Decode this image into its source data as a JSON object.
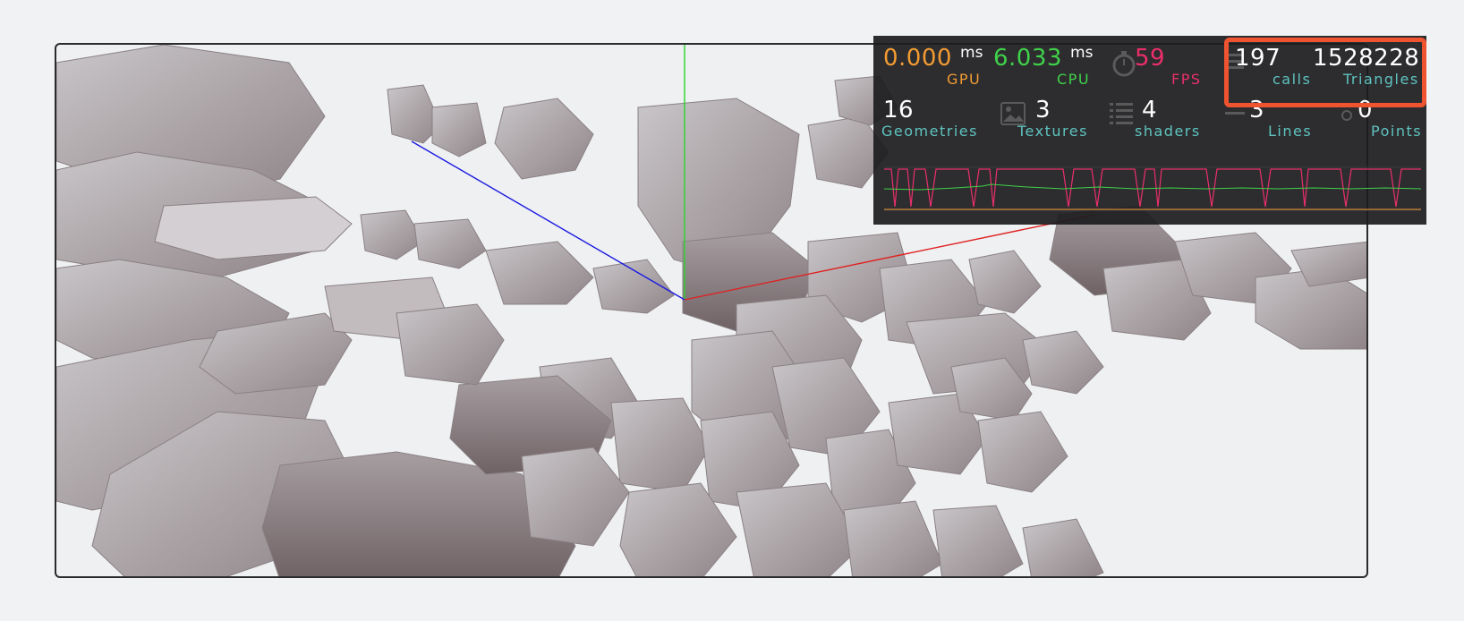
{
  "perf": {
    "gpu": {
      "value": "0.000",
      "unit": "ms",
      "label": "GPU"
    },
    "cpu": {
      "value": "6.033",
      "unit": "ms",
      "label": "CPU"
    },
    "fps": {
      "value": "59",
      "label": "FPS"
    },
    "calls": {
      "value": "197",
      "label": "calls"
    },
    "triangles": {
      "value": "1528228",
      "label": "Triangles"
    },
    "geometries": {
      "value": "16",
      "label": "Geometries"
    },
    "textures": {
      "value": "3",
      "label": "Textures"
    },
    "shaders": {
      "value": "4",
      "label": "shaders"
    },
    "lines": {
      "value": "3",
      "label": "Lines"
    },
    "points": {
      "value": "0",
      "label": "Points"
    }
  },
  "colors": {
    "gpu": "#f29b33",
    "cpu": "#3fd24a",
    "fps": "#ea2f6a",
    "label": "#5ec3bf",
    "highlight": "#f0532f",
    "axis_x": "#e02020",
    "axis_y": "#2bd42b",
    "axis_z": "#1a1ae0"
  },
  "icons": [
    "stopwatch-icon",
    "list-icon",
    "image-icon",
    "shader-lines-icon",
    "line-icon",
    "point-icon"
  ]
}
